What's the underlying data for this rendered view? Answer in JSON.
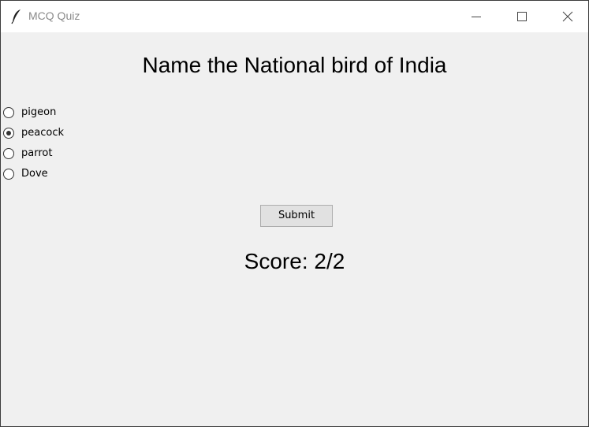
{
  "window": {
    "title": "MCQ Quiz",
    "app_icon": "feather-icon",
    "controls": {
      "minimize_icon": "minimize-icon",
      "maximize_icon": "maximize-icon",
      "close_icon": "close-icon"
    }
  },
  "quiz": {
    "question": "Name the National bird of India",
    "options": [
      {
        "label": "pigeon",
        "selected": false
      },
      {
        "label": "peacock",
        "selected": true
      },
      {
        "label": "parrot",
        "selected": false
      },
      {
        "label": "Dove",
        "selected": false
      }
    ],
    "submit_label": "Submit",
    "score_text": "Score: 2/2"
  }
}
